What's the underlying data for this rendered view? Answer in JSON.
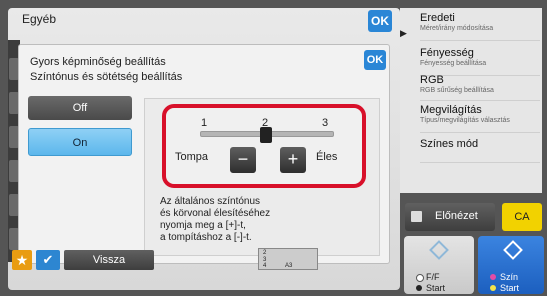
{
  "background_window": {
    "title": "Egyéb",
    "ok_label": "OK"
  },
  "dialog": {
    "title_line1": "Gyors képminőség beállítás",
    "title_line2": "Színtónus és sötétség beállítás",
    "ok_label": "OK",
    "options": {
      "off_label": "Off",
      "on_label": "On",
      "selected": "On"
    },
    "slider": {
      "ticks": [
        "1",
        "2",
        "3"
      ],
      "value": 2,
      "min_label": "Tompa",
      "max_label": "Éles",
      "minus_label": "−",
      "plus_label": "+"
    },
    "description": [
      "Az általános színtónus",
      "és körvonal élesítéséhez",
      "nyomja meg a [+]-t,",
      "a tompításhoz a [-]-t."
    ]
  },
  "right_menu": {
    "items": [
      {
        "title": "Eredeti",
        "subtitle": "Méret/irány módosítása"
      },
      {
        "title": "Fényesség",
        "subtitle": "Fényesség beállítása"
      },
      {
        "title": "RGB",
        "subtitle": "RGB sűrűség beállítása"
      },
      {
        "title": "Megvilágítás",
        "subtitle": "Típus/megvilágítás választás"
      },
      {
        "title": "Színes mód",
        "subtitle": ""
      }
    ]
  },
  "bottom_controls": {
    "preview_label": "Előnézet",
    "ca_label": "CA",
    "ff_start_line1": "F/F",
    "ff_start_line2": "Start",
    "color_start_line1": "Szín",
    "color_start_line2": "Start",
    "back_label": "Vissza",
    "page_indicator": {
      "line1": "2",
      "line2": "3",
      "line3": "4",
      "size": "A3"
    }
  },
  "colors": {
    "accent_blue": "#2a86d6",
    "highlight_red": "#d8102a",
    "selected_option": "#5cb7ec",
    "ca_yellow": "#f2d200",
    "star_orange": "#e99c12"
  }
}
